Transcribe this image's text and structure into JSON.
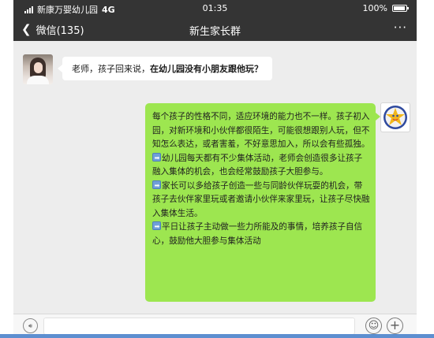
{
  "status_bar": {
    "carrier": "新康万婴幼儿园",
    "network": "4G",
    "time": "01:35",
    "battery": "100%"
  },
  "nav": {
    "back_label": "微信(135)",
    "title": "新生家长群",
    "more_label": "···"
  },
  "messages": {
    "incoming": {
      "text_plain": "老师，孩子回来说，",
      "text_bold": "在幼儿园没有小朋友跟他玩？"
    },
    "outgoing": {
      "paragraphs": [
        "每个孩子的性格不同，适应环境的能力也不一样。孩子初入园，对新环境和小伙伴都很陌生，可能很想跟别人玩，但不知怎么表达，或者害羞，不好意思加入，所以会有些孤独。",
        "幼儿园每天都有不少集体活动，老师会创造很多让孩子融入集体的机会，也会经常鼓励孩子大胆参与。",
        "家长可以多给孩子创造一些与同龄伙伴玩耍的机会，带孩子去伙伴家里玩或者邀请小伙伴来家里玩，让孩子尽快融入集体生活。",
        "平日让孩子主动做一些力所能及的事情，培养孩子自信心，鼓励他大胆参与集体活动"
      ]
    }
  },
  "icons": {
    "voice": "voice-icon",
    "emoji": "emoji-icon",
    "plus": "plus-icon",
    "bullet": "arrow-right-box-icon"
  },
  "colors": {
    "header_bg": "#343434",
    "chat_bg": "#ededed",
    "outgoing_bubble": "#9de650",
    "incoming_bubble": "#ffffff"
  }
}
